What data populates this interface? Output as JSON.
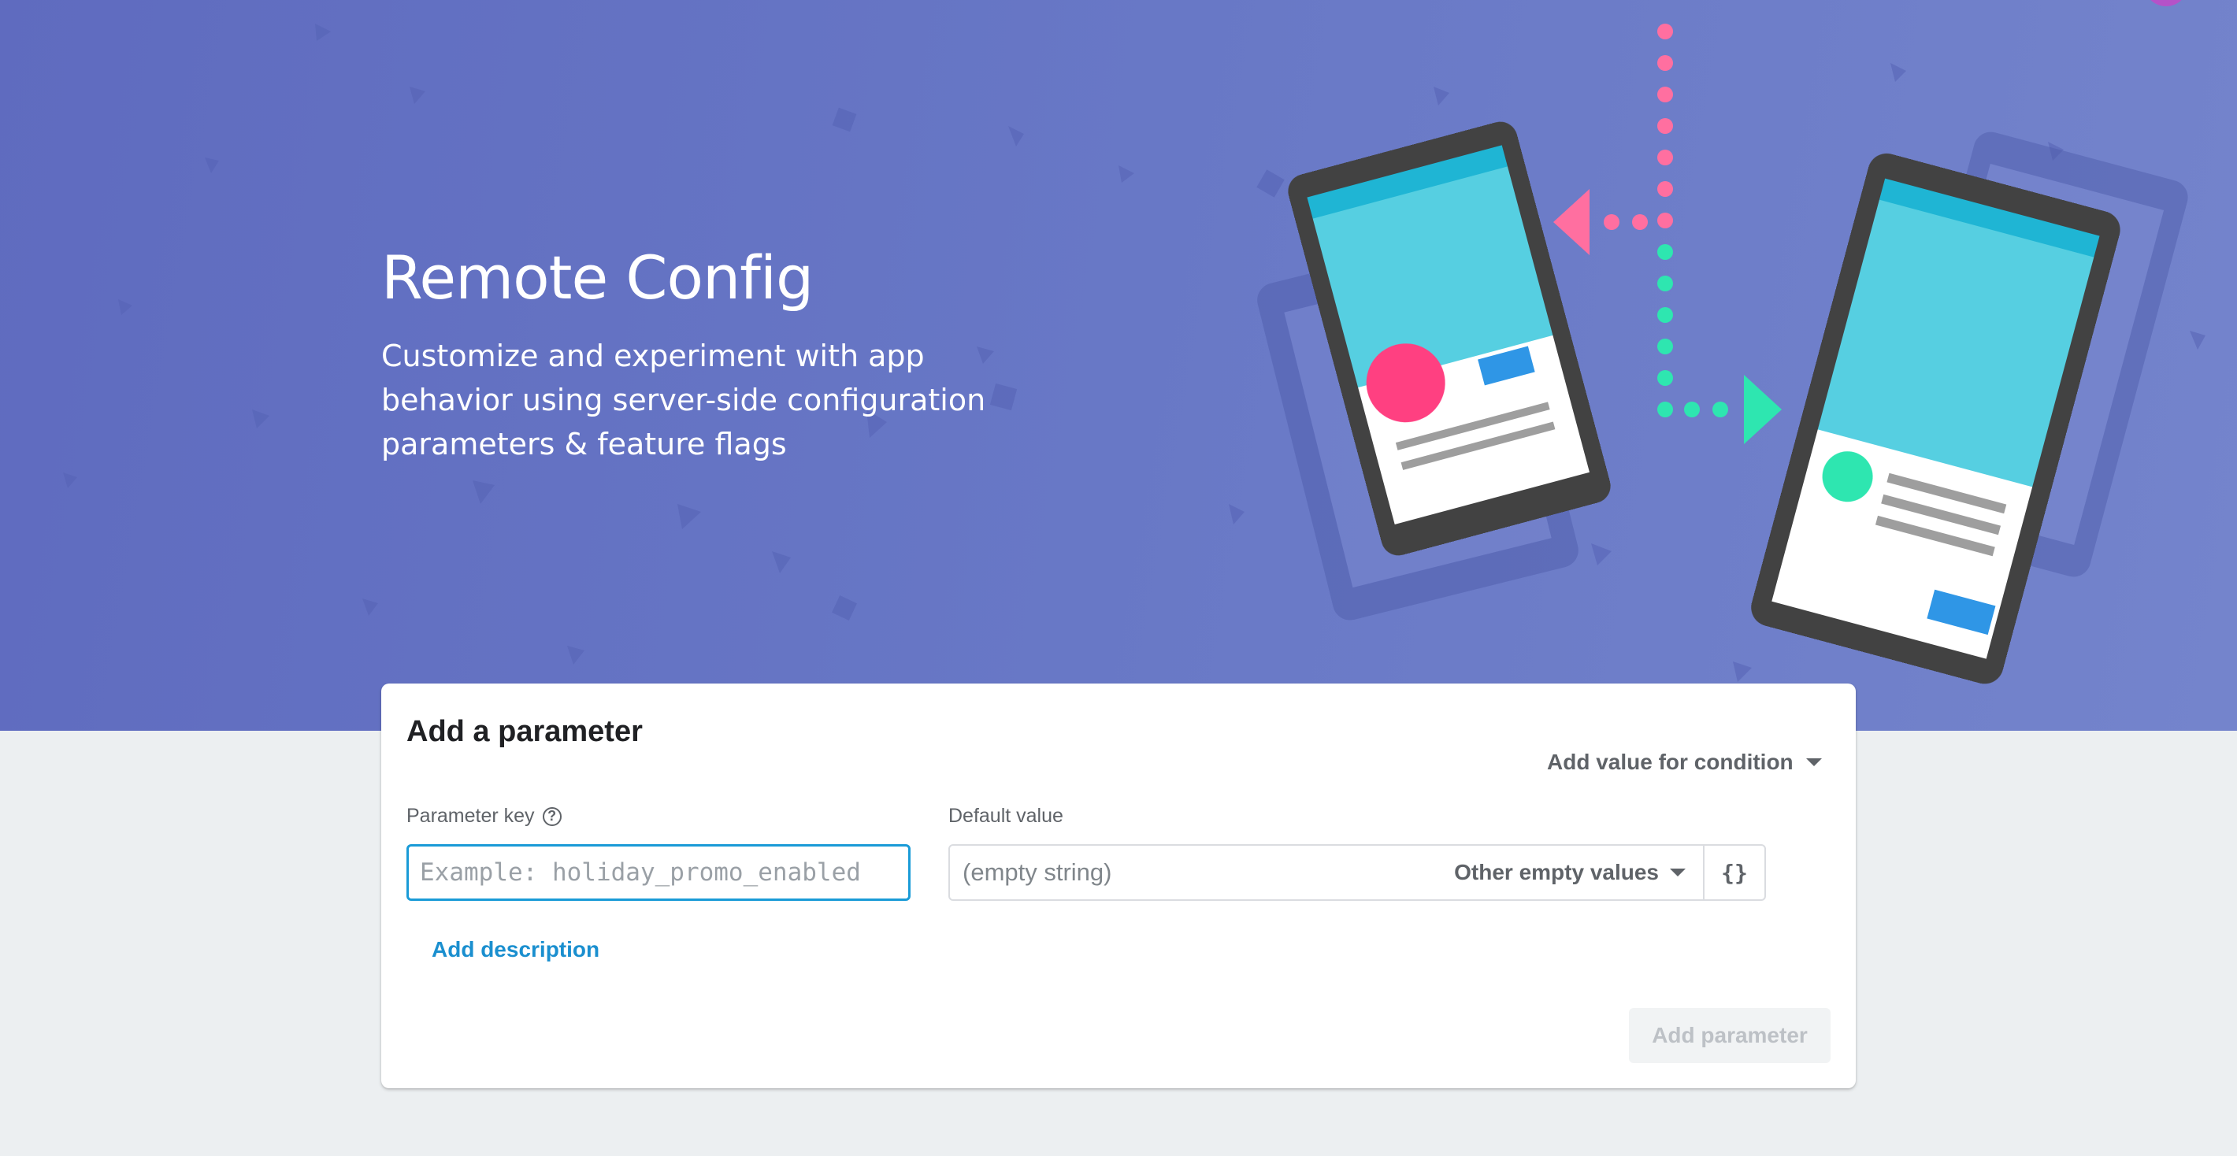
{
  "hero": {
    "title": "Remote Config",
    "subtitle": "Customize and experiment with app behavior using server-side configuration parameters & feature flags"
  },
  "form": {
    "title": "Add a parameter",
    "parameter_key": {
      "label": "Parameter key",
      "placeholder": "Example: holiday_promo_enabled",
      "value": ""
    },
    "default_value": {
      "label": "Default value",
      "placeholder": "(empty string)",
      "value": "",
      "empty_values_label": "Other empty values",
      "json_editor_label": "{}"
    },
    "add_condition_label": "Add value for condition",
    "add_description_label": "Add description",
    "submit_label": "Add parameter"
  },
  "colors": {
    "hero_background": "#6674c3",
    "accent_blue": "#1a9bd7",
    "pink": "#ff4081",
    "teal": "#2ee6b0",
    "page_background": "#eceff1"
  },
  "icons": {
    "help": "help-circle-icon",
    "dropdown": "chevron-down-icon",
    "json": "json-braces-icon"
  }
}
